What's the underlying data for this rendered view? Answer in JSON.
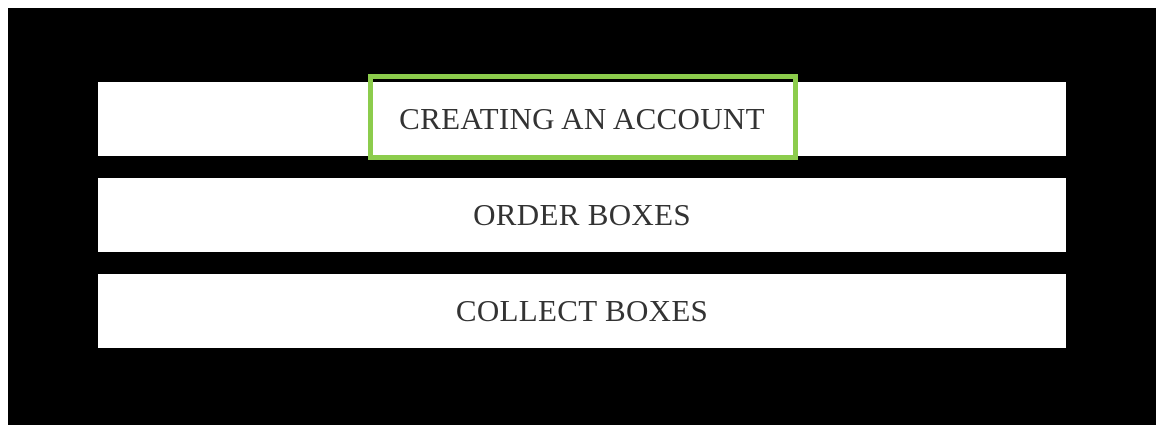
{
  "menu": {
    "items": [
      {
        "label": "CREATING AN ACCOUNT",
        "highlighted": true
      },
      {
        "label": "ORDER BOXES",
        "highlighted": false
      },
      {
        "label": "COLLECT BOXES",
        "highlighted": false
      }
    ]
  },
  "colors": {
    "background": "#000000",
    "button": "#ffffff",
    "text": "#333333",
    "highlight": "#8ccc4c"
  }
}
